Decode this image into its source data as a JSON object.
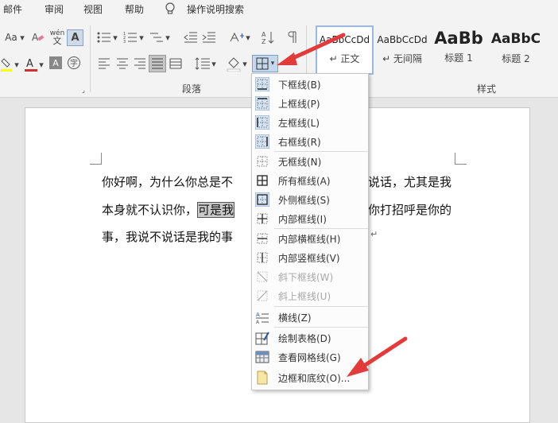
{
  "menubar": {
    "items": [
      "邮件",
      "审阅",
      "视图",
      "帮助",
      "操作说明搜索"
    ]
  },
  "ribbon": {
    "font_size_label": "Aa",
    "phonetic_label": "wén",
    "phonetic_sub": "文",
    "boxed_char": "A",
    "group_paragraph_label": "段落",
    "group_styles_label": "样式",
    "styles": [
      {
        "preview": "AaBbCcDd",
        "name": "↵ 正文",
        "selected": true
      },
      {
        "preview": "AaBbCcDd",
        "name": "↵ 无间隔",
        "selected": false
      },
      {
        "preview": "AaBb",
        "name": "标题 1",
        "selected": false
      },
      {
        "preview": "AaBbC",
        "name": "标题 2",
        "selected": false
      }
    ]
  },
  "document": {
    "line1": "你好啊，为什么你总是不",
    "line1b": "说话，尤其是我",
    "line2a": "本身就不认识你，",
    "line2_selected": "可是我",
    "line2b": "你打招呼是你的",
    "line3": "事，我说不说话是我的事",
    "para_mark": "↵"
  },
  "border_menu": {
    "items": [
      {
        "label": "下框线(B)",
        "icon": "bottom-border-icon",
        "disabled": false
      },
      {
        "label": "上框线(P)",
        "icon": "top-border-icon",
        "disabled": false
      },
      {
        "label": "左框线(L)",
        "icon": "left-border-icon",
        "disabled": false
      },
      {
        "label": "右框线(R)",
        "icon": "right-border-icon",
        "disabled": false
      },
      {
        "label": "无框线(N)",
        "icon": "no-border-icon",
        "disabled": false
      },
      {
        "label": "所有框线(A)",
        "icon": "all-borders-icon",
        "disabled": false
      },
      {
        "label": "外侧框线(S)",
        "icon": "outside-borders-icon",
        "disabled": false
      },
      {
        "label": "内部框线(I)",
        "icon": "inside-borders-icon",
        "disabled": false
      },
      {
        "label": "内部横框线(H)",
        "icon": "inside-horizontal-border-icon",
        "disabled": false
      },
      {
        "label": "内部竖框线(V)",
        "icon": "inside-vertical-border-icon",
        "disabled": false
      },
      {
        "label": "斜下框线(W)",
        "icon": "diagonal-down-border-icon",
        "disabled": true
      },
      {
        "label": "斜上框线(U)",
        "icon": "diagonal-up-border-icon",
        "disabled": true
      },
      {
        "label": "横线(Z)",
        "icon": "horizontal-line-icon",
        "disabled": false
      },
      {
        "label": "绘制表格(D)",
        "icon": "draw-table-icon",
        "disabled": false
      },
      {
        "label": "查看网格线(G)",
        "icon": "view-gridlines-icon",
        "disabled": false
      },
      {
        "label": "边框和底纹(O)...",
        "icon": "borders-shading-icon",
        "disabled": false
      }
    ]
  },
  "colors": {
    "accent": "#2b579a",
    "arrow": "#e23b3b",
    "highlight_yellow": "#ffff00",
    "font_red": "#d32f2f"
  }
}
